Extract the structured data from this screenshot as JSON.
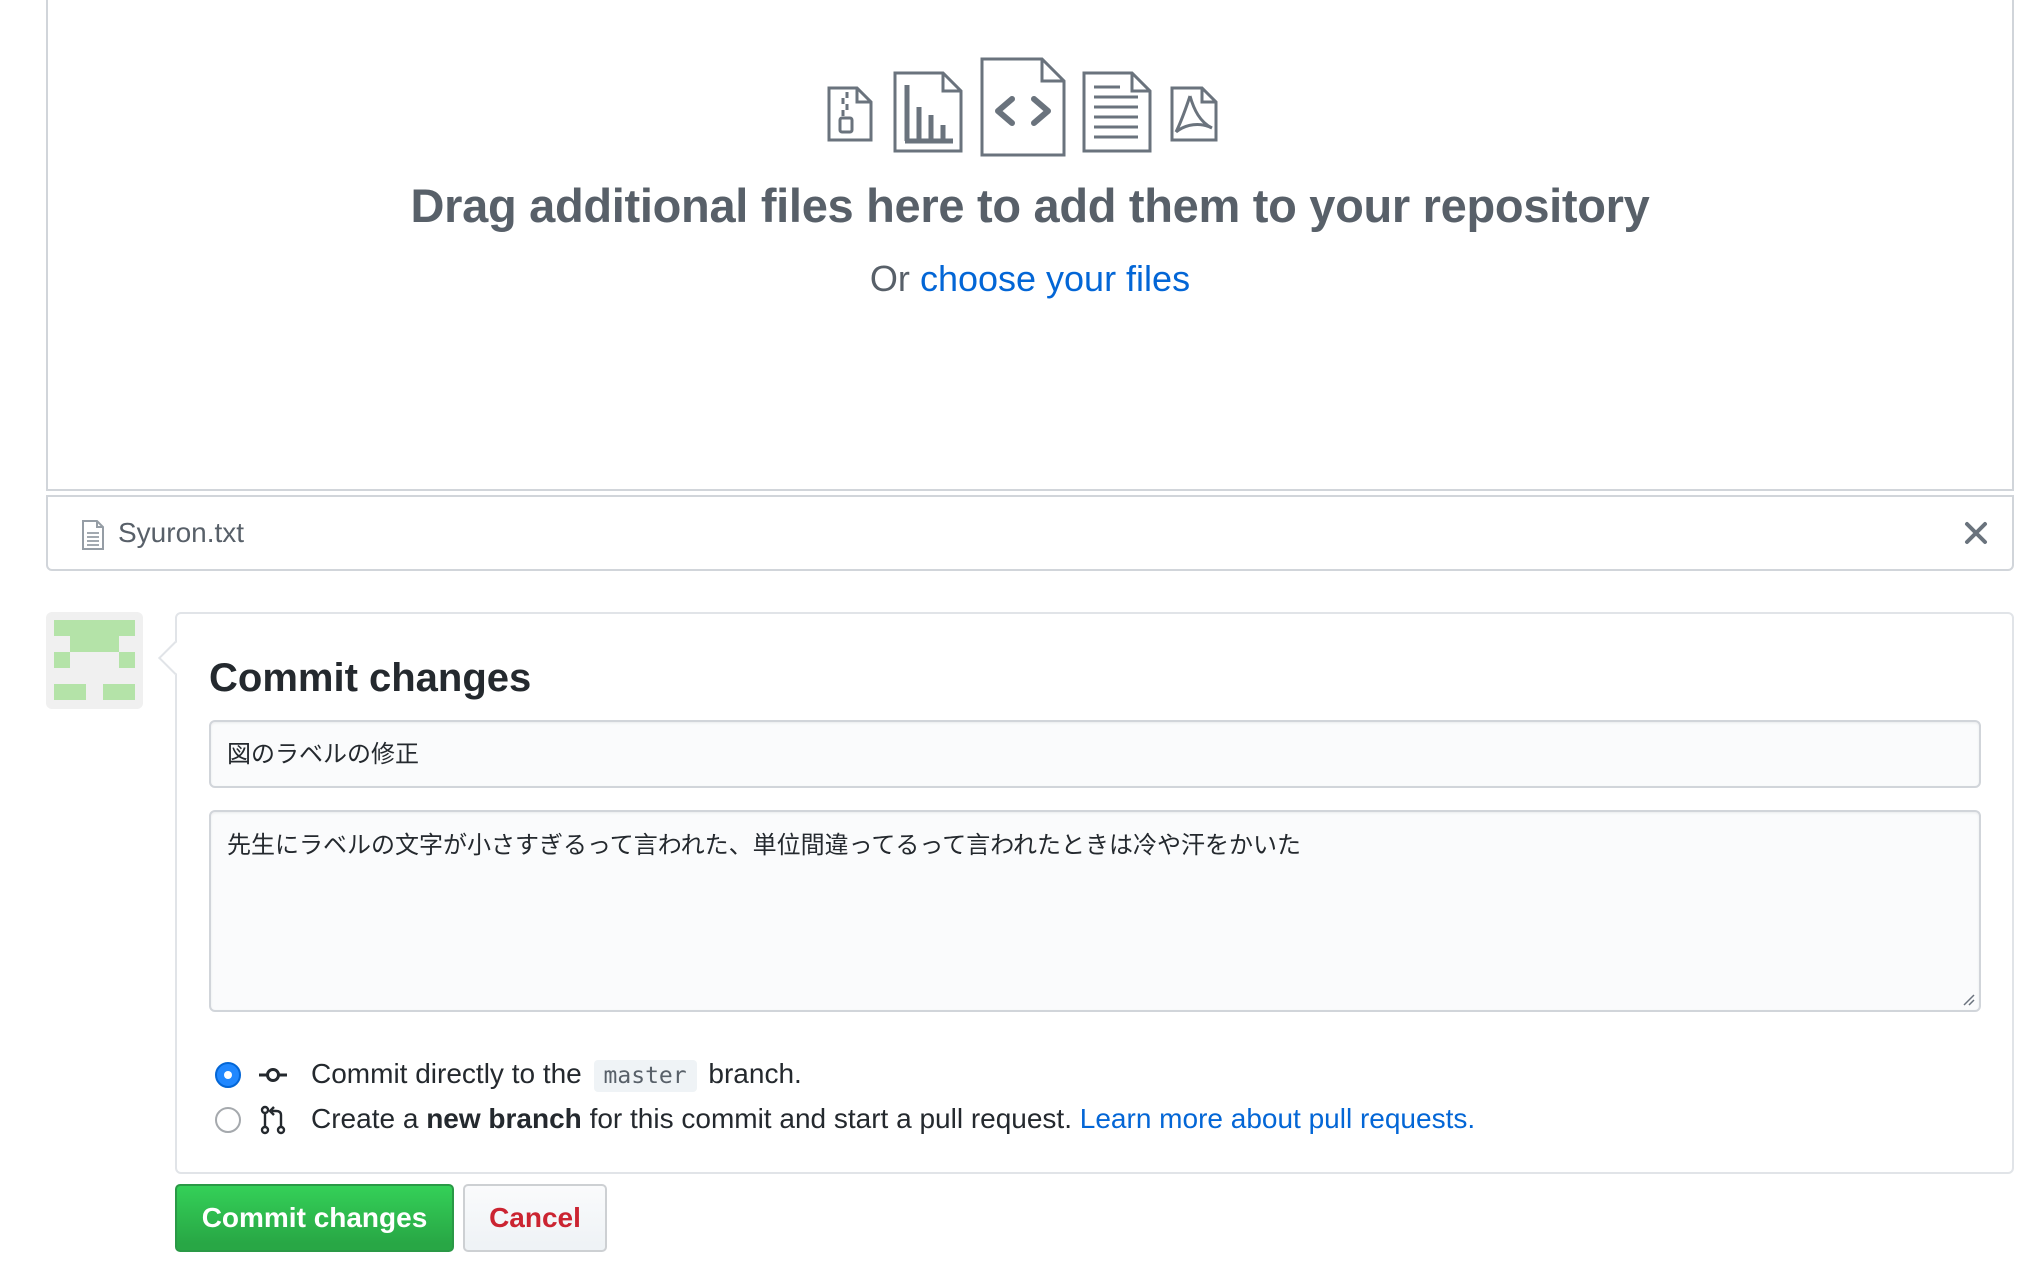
{
  "dropzone": {
    "title": "Drag additional files here to add them to your repository",
    "or_text": "Or",
    "choose_link": "choose your files",
    "file_type_icons": [
      "zip-file-icon",
      "chart-file-icon",
      "code-file-icon",
      "text-file-icon",
      "pdf-file-icon"
    ]
  },
  "uploaded_file": {
    "name": "Syuron.txt"
  },
  "commit": {
    "heading": "Commit changes",
    "summary": "図のラベルの修正",
    "description": "先生にラベルの文字が小さすぎるって言われた、単位間違ってるって言われたときは冷や汗をかいた",
    "option_direct": {
      "before": "Commit directly to the",
      "branch": "master",
      "after": "branch.",
      "selected": true
    },
    "option_new_branch": {
      "before": "Create a",
      "bold": "new branch",
      "after": "for this commit and start a pull request.",
      "link": "Learn more about pull requests.",
      "selected": false
    }
  },
  "buttons": {
    "commit": "Commit changes",
    "cancel": "Cancel"
  },
  "colors": {
    "link": "#0366d6",
    "primary_button": "#28a745",
    "cancel_text": "#cb2431",
    "radio_selected": "#2188ff",
    "avatar_green": "#b4e3a8"
  }
}
